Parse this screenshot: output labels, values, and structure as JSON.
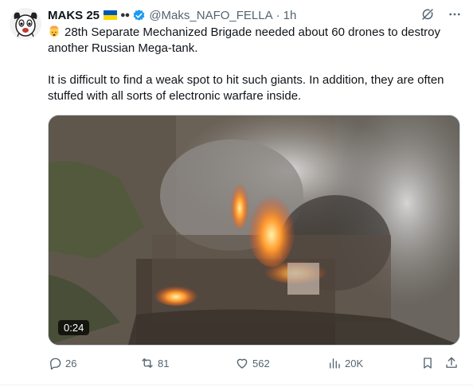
{
  "author": {
    "display_name": "MAKS 25",
    "flag_emoji": "ukraine-flag",
    "extra_emoji": "eyes",
    "handle": "@Maks_NAFO_FELLA",
    "separator": "·",
    "time": "1h",
    "verified": true
  },
  "header_icons": [
    "grok-icon",
    "more-icon"
  ],
  "tweet": {
    "emoji": "exploding-head",
    "line1": "28th Separate Mechanized Brigade needed about 60 drones to destroy another Russian Mega-tank.",
    "line2": "It is difficult to find a weak spot to hit such giants. In addition, they are often stuffed with all sorts of electronic warfare inside."
  },
  "media": {
    "type": "video",
    "duration": "0:24"
  },
  "actions": {
    "replies": "26",
    "reposts": "81",
    "likes": "562",
    "views": "20K"
  },
  "colors": {
    "text": "#0f1419",
    "secondary": "#536471",
    "verified": "#1d9bf0",
    "fire": "#f26b1d"
  }
}
